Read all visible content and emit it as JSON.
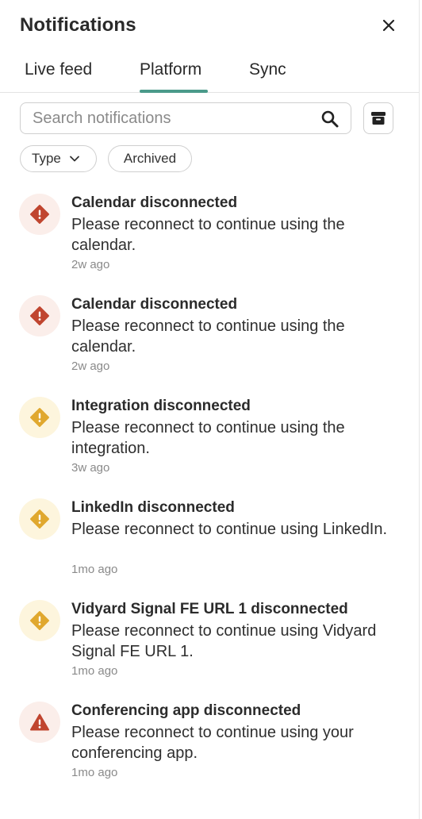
{
  "header": {
    "title": "Notifications",
    "close_icon": "close-icon"
  },
  "tabs": [
    {
      "label": "Live feed",
      "active": false
    },
    {
      "label": "Platform",
      "active": true
    },
    {
      "label": "Sync",
      "active": false
    }
  ],
  "colors": {
    "accent": "#4a9a8a",
    "error": "#c0452f",
    "warning": "#e0a82e"
  },
  "search": {
    "placeholder": "Search notifications",
    "icon": "search-icon"
  },
  "archive_button": {
    "icon": "archive-icon"
  },
  "filters": [
    {
      "label": "Type",
      "icon": "chevron-down-icon"
    },
    {
      "label": "Archived"
    }
  ],
  "notifications": [
    {
      "title": "Calendar disconnected",
      "body": "Please reconnect to continue using the calendar.",
      "time": "2w ago",
      "severity": "error",
      "icon": "error-diamond-icon"
    },
    {
      "title": "Calendar disconnected",
      "body": "Please reconnect to continue using the calendar.",
      "time": "2w ago",
      "severity": "error",
      "icon": "error-diamond-icon"
    },
    {
      "title": "Integration disconnected",
      "body": "Please reconnect to continue using the integration.",
      "time": "3w ago",
      "severity": "warning",
      "icon": "warning-diamond-icon"
    },
    {
      "title": "LinkedIn disconnected",
      "body": "Please reconnect to continue using LinkedIn.",
      "time": "1mo ago",
      "severity": "warning",
      "icon": "warning-diamond-icon"
    },
    {
      "title": "Vidyard Signal FE URL 1 disconnected",
      "body": "Please reconnect to continue using Vidyard Signal FE URL 1.",
      "time": "1mo ago",
      "severity": "warning",
      "icon": "warning-diamond-icon"
    },
    {
      "title": "Conferencing app disconnected",
      "body": "Please reconnect to continue using your conferencing app.",
      "time": "1mo ago",
      "severity": "error",
      "icon": "alert-triangle-icon"
    }
  ]
}
